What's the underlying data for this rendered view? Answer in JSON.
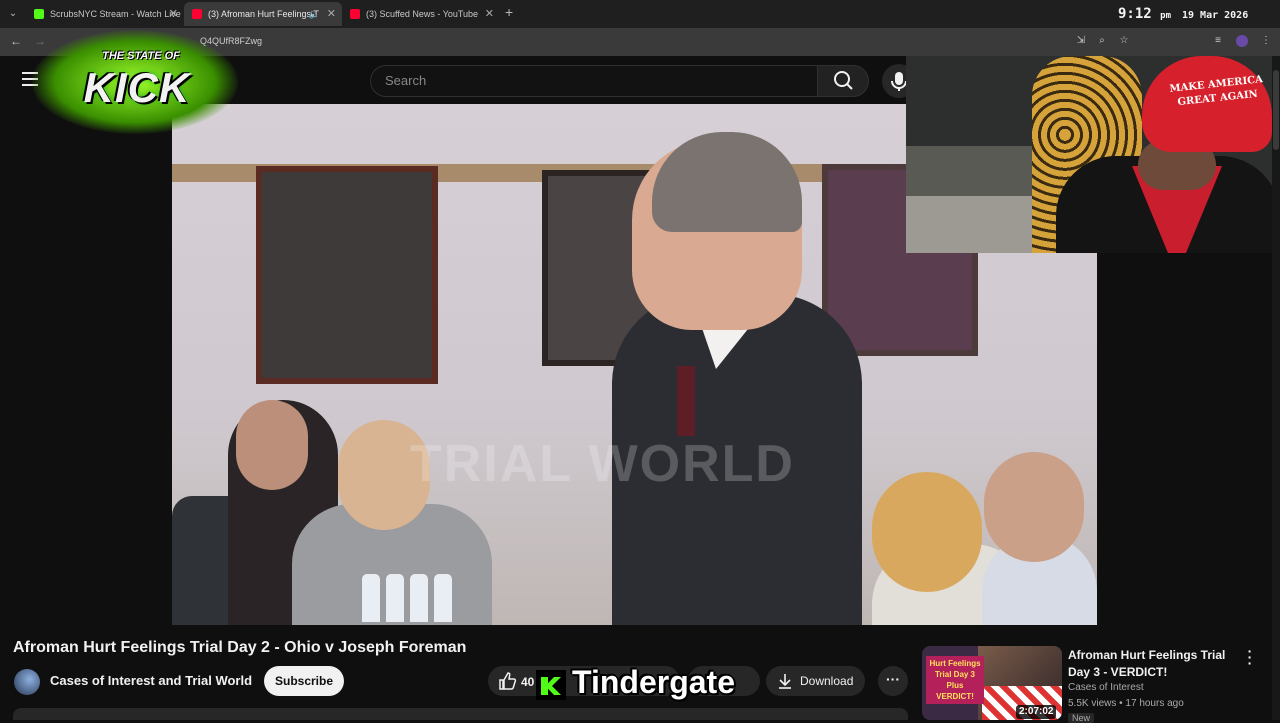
{
  "browser": {
    "tabs": [
      {
        "label": "ScrubsNYC Stream - Watch Live",
        "favicon_color": "#53fc18"
      },
      {
        "label": "(3) Afroman Hurt Feelings T",
        "favicon_color": "#ff0033"
      },
      {
        "label": "(3) Scuffed News - YouTube",
        "favicon_color": "#ff0033"
      }
    ],
    "url": "Q4QUfR8FZwg"
  },
  "clock": {
    "time": "9:12",
    "ampm": "pm",
    "date": "19 Mar 2026"
  },
  "overlay": {
    "logo_top": "THE STATE OF",
    "logo_word": "KICK",
    "webcam_hat": "MAKE AMERICA GREAT AGAIN",
    "banner_text": "Tindergate",
    "kick_green": "#53fc18"
  },
  "masthead": {
    "search_placeholder": "Search"
  },
  "video": {
    "watermark": "TRIAL WORLD"
  },
  "watch": {
    "title": "Afroman Hurt Feelings Trial Day 2 - Ohio v Joseph Foreman",
    "channel": "Cases of Interest and Trial World",
    "subscribe_label": "Subscribe",
    "like_count": "40",
    "download_label": "Download"
  },
  "recommended": {
    "title": "Afroman Hurt Feelings Trial Day 3 - VERDICT!",
    "channel": "Cases of Interest",
    "meta": "5.5K views • 17 hours ago",
    "badge": "New",
    "duration": "2:07:02",
    "thumb_text": "Hurt Feelings Trial Day 3 Plus VERDICT!"
  }
}
